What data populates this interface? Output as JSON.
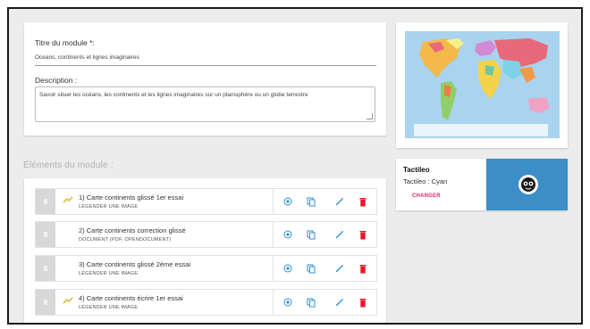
{
  "form": {
    "title_label": "Titre du module *:",
    "title_value": "Oceans, continents et lignes imaginaires",
    "description_label": "Description :",
    "description_value": "Savoir situer les océans, les continents et les lignes imaginaires sur un planisphère ou un globe terrestre"
  },
  "section_title": "Éléments du module :",
  "elements": [
    {
      "title": "1) Carte continents glissé 1er essai",
      "subtitle": "LÉGENDER UNE IMAGE",
      "warning": true
    },
    {
      "title": "2) Carte continents correction glissé",
      "subtitle": "DOCUMENT (PDF, OPENDOCUMENT)",
      "warning": false
    },
    {
      "title": "3) Carte continents glissé 2ème essai",
      "subtitle": "LÉGENDER UNE IMAGE",
      "warning": false
    },
    {
      "title": "4) Carte continents écrire 1er essai",
      "subtitle": "LÉGENDER UNE IMAGE",
      "warning": true
    }
  ],
  "tactileo": {
    "name": "Tactileo",
    "theme": "Tactileo : Cyan",
    "change_label": "CHANGER",
    "color": "#3d8ec7"
  },
  "icons": [
    "drag-handle-icon",
    "warning-icon",
    "preview-icon",
    "duplicate-icon",
    "edit-icon",
    "delete-icon",
    "world-map-image",
    "tactileo-logo-icon"
  ],
  "colors": {
    "accent_blue": "#2f8fd0",
    "delete_red": "#e3172b",
    "change_pink": "#e0246f",
    "warning_yellow": "#e2b32c"
  }
}
